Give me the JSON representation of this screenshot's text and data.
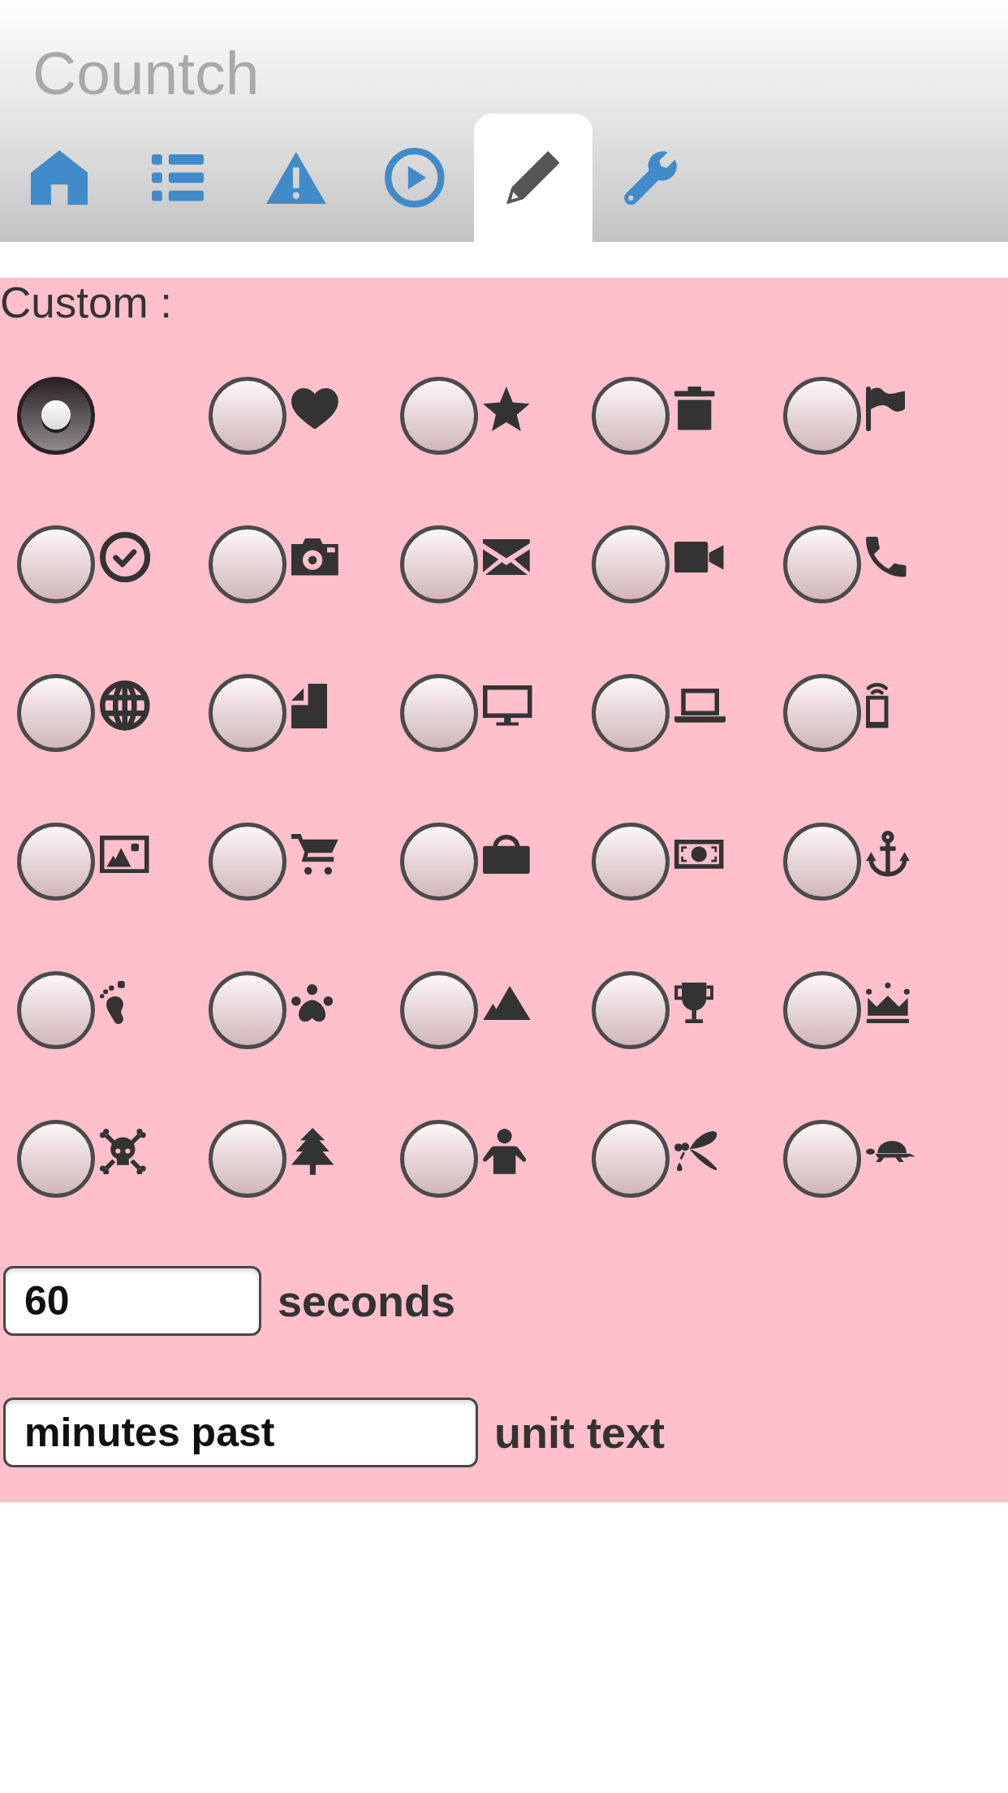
{
  "header": {
    "title": "Countch"
  },
  "tabs": [
    {
      "kind": "home",
      "selected": false
    },
    {
      "kind": "list",
      "selected": false
    },
    {
      "kind": "warning",
      "selected": false
    },
    {
      "kind": "play",
      "selected": false
    },
    {
      "kind": "pencil",
      "selected": true
    },
    {
      "kind": "wrench",
      "selected": false
    }
  ],
  "custom": {
    "label": "Custom :",
    "options": [
      {
        "kind": "plain",
        "selected": true
      },
      {
        "kind": "heart",
        "selected": false
      },
      {
        "kind": "star",
        "selected": false
      },
      {
        "kind": "trash",
        "selected": false
      },
      {
        "kind": "flag",
        "selected": false
      },
      {
        "kind": "check",
        "selected": false
      },
      {
        "kind": "camera",
        "selected": false
      },
      {
        "kind": "envelope",
        "selected": false
      },
      {
        "kind": "video",
        "selected": false
      },
      {
        "kind": "phone",
        "selected": false
      },
      {
        "kind": "globe",
        "selected": false
      },
      {
        "kind": "file",
        "selected": false
      },
      {
        "kind": "monitor",
        "selected": false
      },
      {
        "kind": "laptop",
        "selected": false
      },
      {
        "kind": "mobile",
        "selected": false
      },
      {
        "kind": "image",
        "selected": false
      },
      {
        "kind": "cart",
        "selected": false
      },
      {
        "kind": "bag",
        "selected": false
      },
      {
        "kind": "money",
        "selected": false
      },
      {
        "kind": "anchor",
        "selected": false
      },
      {
        "kind": "footprint",
        "selected": false
      },
      {
        "kind": "paw",
        "selected": false
      },
      {
        "kind": "mountain",
        "selected": false
      },
      {
        "kind": "trophy",
        "selected": false
      },
      {
        "kind": "crown",
        "selected": false
      },
      {
        "kind": "skull",
        "selected": false
      },
      {
        "kind": "tree",
        "selected": false
      },
      {
        "kind": "person",
        "selected": false
      },
      {
        "kind": "insect",
        "selected": false
      },
      {
        "kind": "turtle",
        "selected": false
      }
    ],
    "fields": [
      {
        "kind": "number",
        "value": "60",
        "suffix": "seconds"
      },
      {
        "kind": "text",
        "value": "minutes past",
        "suffix": "unit text"
      }
    ]
  }
}
